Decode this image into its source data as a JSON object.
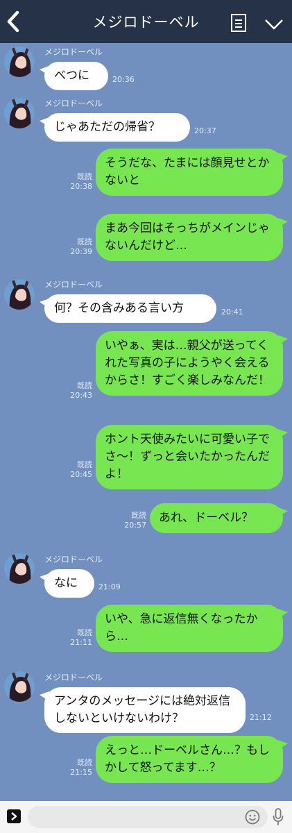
{
  "header": {
    "title": "メジロドーベル"
  },
  "contact": {
    "name": "メジロドーベル"
  },
  "receipt_label": "既読",
  "messages": [
    {
      "side": "in",
      "text": "べつに",
      "time": "20:36"
    },
    {
      "side": "in",
      "text": "じゃあただの帰省？",
      "time": "20:37"
    },
    {
      "side": "out",
      "text": "そうだな、たまには顔見せとかないと",
      "time": "20:38"
    },
    {
      "side": "out",
      "text": "まあ今回はそっちがメインじゃないんだけど…",
      "time": "20:39"
    },
    {
      "side": "in",
      "text": "何？その含みある言い方",
      "time": "20:41"
    },
    {
      "side": "out",
      "text": "いやぁ、実は…親父が送ってくれた写真の子にようやく会えるからさ！すごく楽しみなんだ！",
      "time": "20:43"
    },
    {
      "side": "out",
      "text": "ホント天使みたいに可愛い子でさ～！ずっと会いたかったんだよ！",
      "time": "20:45"
    },
    {
      "side": "out",
      "text": "あれ、ドーベル？",
      "time": "20:57"
    },
    {
      "side": "in",
      "text": "なに",
      "time": "21:09"
    },
    {
      "side": "out",
      "text": "いや、急に返信無くなったから…",
      "time": "21:11"
    },
    {
      "side": "in",
      "text": "アンタのメッセージには絶対返信しないといけないわけ？",
      "time": "21:12"
    },
    {
      "side": "out",
      "text": "えっと…ドーベルさん…？もしかして怒ってます…？",
      "time": "21:15"
    }
  ],
  "icons": [
    "back-arrow-icon",
    "menu-list-icon",
    "chevron-down-icon",
    "expand-arrow-icon",
    "emoji-icon",
    "microphone-icon"
  ],
  "colors": {
    "background": "#7290bf",
    "header": "#263248",
    "outgoing": "#78e650",
    "incoming": "#ffffff"
  }
}
